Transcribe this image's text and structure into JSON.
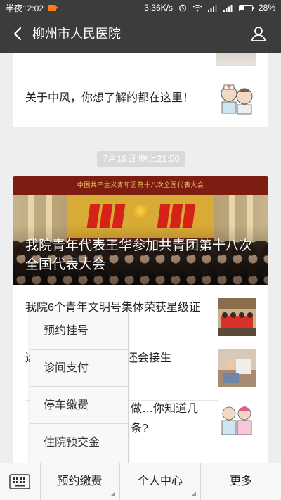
{
  "status_bar": {
    "time": "半夜12:02",
    "speed": "3.36K/s",
    "battery": "28%"
  },
  "header": {
    "title": "柳州市人民医院"
  },
  "card_previous": {
    "items": [
      {
        "title": "关于中风，你想了解的都在这里！"
      }
    ]
  },
  "timestamp": "7月19日 晚上21:50",
  "card_news": {
    "banner_headline": "我院青年代表王华参加共青团第十八次全国代表大会",
    "banner_stage_text": "中国共产主义青年团第十八次全国代表大会",
    "items": [
      {
        "title": "我院6个青年文明号集体荣获星级证"
      },
      {
        "title": "这个世界医院，竟然还会接生"
      },
      {
        "title": "做…你知道几条?"
      }
    ]
  },
  "popup_menu": {
    "items": [
      {
        "label": "预约挂号"
      },
      {
        "label": "诊间支付"
      },
      {
        "label": "停车缴费"
      },
      {
        "label": "住院预交金"
      }
    ]
  },
  "bottom_nav": {
    "tabs": [
      {
        "label": "预约缴费"
      },
      {
        "label": "个人中心"
      },
      {
        "label": "更多"
      }
    ]
  },
  "colors": {
    "bar_bg": "#3c3c3c",
    "page_bg": "#eeeeee",
    "record_icon": "#ff7a1a"
  }
}
